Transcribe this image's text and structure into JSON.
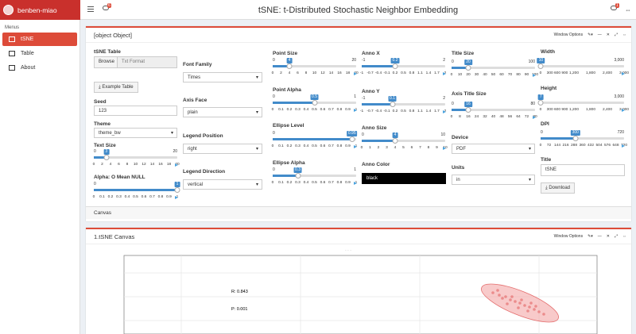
{
  "app": {
    "user": "benben-miao",
    "title": "tSNE: t-Distributed Stochastic Neighbor Embedding",
    "badge_left": "6",
    "badge_right": "1"
  },
  "sidebar": {
    "menus_label": "Menus",
    "items": [
      {
        "label": "tSNE",
        "icon": "chart-icon"
      },
      {
        "label": "Table",
        "icon": "table-icon"
      },
      {
        "label": "About",
        "icon": "info-icon"
      }
    ]
  },
  "options_box": {
    "title": {
      "label": "Title",
      "value": "tSNE"
    },
    "window_options": "Window Options",
    "canvas_label": "Canvas",
    "tsne_table": {
      "label": "tSNE Table",
      "browse": "Browse",
      "placeholder": "Txt Format"
    },
    "example_button": "Example Table",
    "seed": {
      "label": "Seed",
      "value": "123"
    },
    "theme": {
      "label": "Theme",
      "value": "theme_bw"
    },
    "text_size": {
      "label": "Text Size",
      "min": "0",
      "max": "20",
      "value": "3",
      "fraction": 0.15,
      "ticks": [
        "0",
        "2",
        "4",
        "6",
        "8",
        "10",
        "12",
        "14",
        "16",
        "18",
        "20"
      ]
    },
    "alpha_mean": {
      "label": "Alpha: O Mean NULL",
      "min": "0",
      "max": "1",
      "value": "1",
      "fraction": 1.0,
      "ticks": [
        "0",
        "0.1",
        "0.2",
        "0.3",
        "0.4",
        "0.5",
        "0.6",
        "0.7",
        "0.8",
        "0.9",
        "1"
      ]
    },
    "font_family": {
      "label": "Font Family",
      "value": "Times"
    },
    "axis_face": {
      "label": "Axis Face",
      "value": "plain"
    },
    "legend_position": {
      "label": "Legend Position",
      "value": "right"
    },
    "legend_direction": {
      "label": "Legend Direction",
      "value": "vertical"
    },
    "point_size": {
      "label": "Point Size",
      "min": "0",
      "max": "20",
      "value": "4",
      "fraction": 0.2,
      "ticks": [
        "0",
        "2",
        "4",
        "6",
        "8",
        "10",
        "12",
        "14",
        "16",
        "18",
        "20"
      ]
    },
    "point_alpha": {
      "label": "Point Alpha",
      "min": "0",
      "max": "1",
      "value": "0.5",
      "fraction": 0.5,
      "ticks": [
        "0",
        "0.1",
        "0.2",
        "0.3",
        "0.4",
        "0.5",
        "0.6",
        "0.7",
        "0.8",
        "0.9",
        "1"
      ]
    },
    "ellipse_level": {
      "label": "Ellipse Level",
      "min": "0",
      "max": "1",
      "value": "0.95",
      "fraction": 0.95,
      "ticks": [
        "0",
        "0.1",
        "0.2",
        "0.3",
        "0.4",
        "0.5",
        "0.6",
        "0.7",
        "0.8",
        "0.9",
        "1"
      ]
    },
    "ellipse_alpha": {
      "label": "Ellipse Alpha",
      "min": "0",
      "max": "1",
      "value": "0.3",
      "fraction": 0.3,
      "ticks": [
        "0",
        "0.1",
        "0.2",
        "0.3",
        "0.4",
        "0.5",
        "0.6",
        "0.7",
        "0.8",
        "0.9",
        "1"
      ]
    },
    "anno_x": {
      "label": "Anno X",
      "min": "-1",
      "max": "2",
      "value": "0.2",
      "fraction": 0.4,
      "ticks": [
        "-1",
        "-0.7",
        "-0.4",
        "-0.1",
        "0.2",
        "0.5",
        "0.8",
        "1.1",
        "1.4",
        "1.7",
        "2"
      ]
    },
    "anno_y": {
      "label": "Anno Y",
      "min": "-1",
      "max": "2",
      "value": "0.1",
      "fraction": 0.3667,
      "ticks": [
        "-1",
        "-0.7",
        "-0.4",
        "-0.1",
        "0.2",
        "0.5",
        "0.8",
        "1.1",
        "1.4",
        "1.7",
        "2"
      ]
    },
    "anno_size": {
      "label": "Anno Size",
      "min": "0",
      "max": "10",
      "value": "4",
      "fraction": 0.4,
      "ticks": [
        "0",
        "1",
        "2",
        "3",
        "4",
        "5",
        "6",
        "7",
        "8",
        "9",
        "10"
      ]
    },
    "anno_color": {
      "label": "Anno Color",
      "value": "black"
    },
    "title_size": {
      "label": "Title Size",
      "min": "0",
      "max": "100",
      "value": "20",
      "fraction": 0.2,
      "ticks": [
        "0",
        "10",
        "20",
        "30",
        "40",
        "50",
        "60",
        "70",
        "80",
        "90",
        "100"
      ]
    },
    "axis_title_size": {
      "label": "Axis Title Size",
      "min": "0",
      "max": "80",
      "value": "16",
      "fraction": 0.2,
      "ticks": [
        "0",
        "8",
        "16",
        "24",
        "32",
        "40",
        "48",
        "56",
        "64",
        "72",
        "80"
      ]
    },
    "device": {
      "label": "Device",
      "value": "PDF"
    },
    "units": {
      "label": "Units",
      "value": "in"
    },
    "width": {
      "label": "Width",
      "min": "0",
      "max": "3,000",
      "value": "10",
      "fraction": 0.0033,
      "ticks": [
        "0",
        "300",
        "600",
        "900",
        "1,200",
        "1,500",
        "1,800",
        "2,100",
        "2,400",
        "2,700",
        "3,000"
      ],
      "tick_text": [
        "0",
        "300 600 900",
        "1,200",
        "1,800",
        "2,400",
        "3,000"
      ]
    },
    "height": {
      "label": "Height",
      "min": "0",
      "max": "3,000",
      "value": "7",
      "fraction": 0.0023,
      "tick_text": [
        "0",
        "300 600 900",
        "1,200",
        "1,800",
        "2,400",
        "3,000"
      ]
    },
    "dpi": {
      "label": "DPI",
      "min": "0",
      "max": "720",
      "value": "300",
      "fraction": 0.4167,
      "tick_text": [
        "0",
        "72",
        "144",
        "216",
        "288",
        "360",
        "432",
        "504",
        "576",
        "648",
        "720"
      ]
    },
    "download_button": "Download"
  },
  "canvas_box": {
    "title": "1.tSNE Canvas",
    "window_options": "Window Options",
    "annotation_r": "R: 0.843",
    "annotation_p": "P: 0.001",
    "colors": {
      "ellipse": "#f4a6a6",
      "points": "#e77c7c"
    }
  }
}
